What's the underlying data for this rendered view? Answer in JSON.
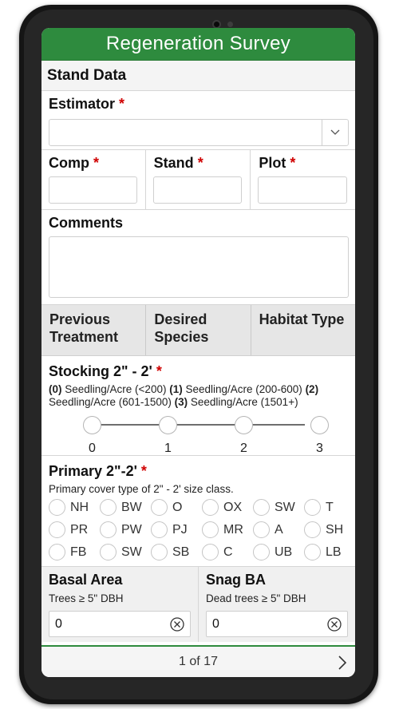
{
  "app": {
    "title": "Regeneration Survey"
  },
  "section": {
    "title": "Stand Data"
  },
  "estimator": {
    "label": "Estimator",
    "required_mark": "*",
    "value": ""
  },
  "comp": {
    "label": "Comp",
    "required_mark": "*",
    "value": ""
  },
  "stand": {
    "label": "Stand",
    "required_mark": "*",
    "value": ""
  },
  "plot": {
    "label": "Plot",
    "required_mark": "*",
    "value": ""
  },
  "comments": {
    "label": "Comments",
    "value": ""
  },
  "tabs": [
    {
      "label": "Previous Treatment"
    },
    {
      "label": "Desired Species"
    },
    {
      "label": "Habitat Type"
    }
  ],
  "stocking": {
    "label": "Stocking 2\" - 2'",
    "required_mark": "*",
    "hint_parts": [
      "(0)",
      " Seedling/Acre (<200) ",
      "(1)",
      " Seedling/Acre (200-600) ",
      "(2)",
      " Seedling/Acre (601-1500) ",
      "(3)",
      " Seedling/Acre (1501+)"
    ],
    "options": [
      "0",
      "1",
      "2",
      "3"
    ]
  },
  "primary": {
    "label": "Primary 2\"-2'",
    "required_mark": "*",
    "hint": "Primary cover type of 2\" - 2' size class.",
    "options": [
      "NH",
      "BW",
      "O",
      "OX",
      "SW",
      "T",
      "PR",
      "PW",
      "PJ",
      "MR",
      "A",
      "SH",
      "FB",
      "SW",
      "SB",
      "C",
      "UB",
      "LB"
    ]
  },
  "basal_area": {
    "label": "Basal Area",
    "hint": "Trees ≥ 5\" DBH",
    "value": "0"
  },
  "snag_ba": {
    "label": "Snag BA",
    "hint": "Dead trees ≥ 5\" DBH",
    "value": "0"
  },
  "pager": {
    "text": "1 of 17"
  },
  "colors": {
    "title_bar": "#2e8b3e",
    "required": "#d00000"
  },
  "icons": {
    "dropdown": "chevron-down-icon",
    "clear": "clear-circle-x-icon",
    "next": "chevron-right-icon"
  }
}
